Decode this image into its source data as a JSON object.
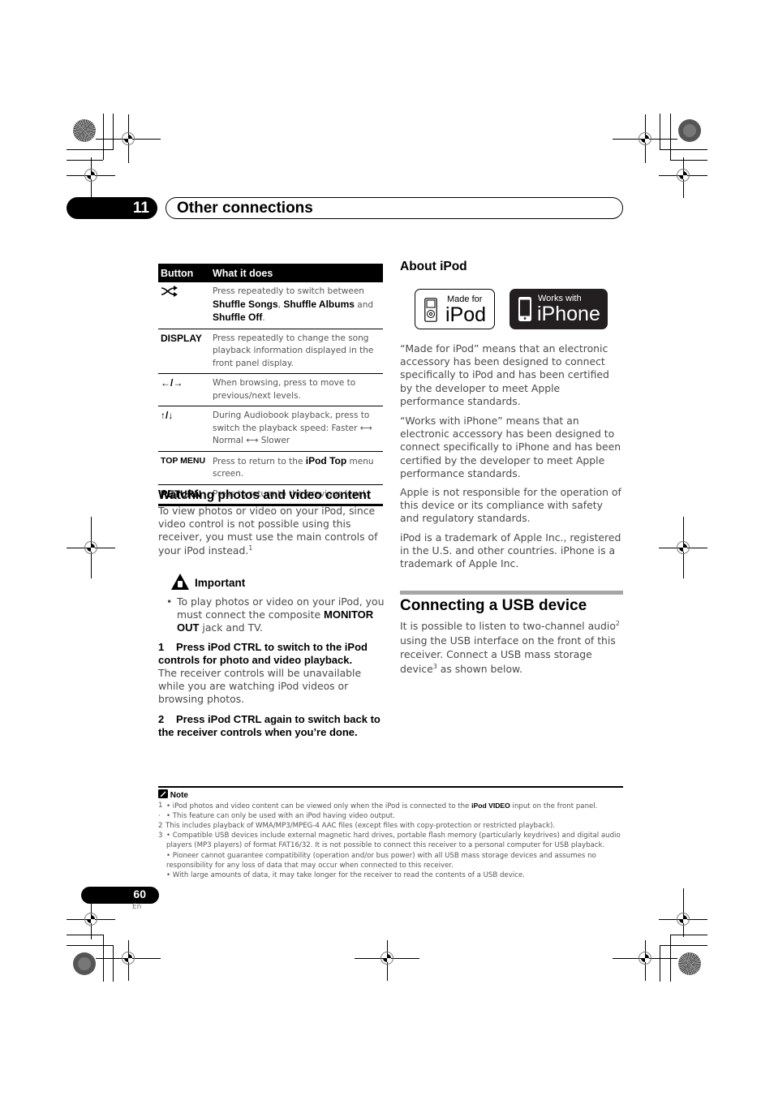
{
  "chapter": {
    "number": "11",
    "title": "Other connections"
  },
  "table": {
    "headers": [
      "Button",
      "What it does"
    ],
    "rows": [
      {
        "button_icon": "shuffle-icon",
        "button": "",
        "desc_parts": [
          "Press repeatedly to switch between ",
          "Shuffle Songs",
          ", ",
          "Shuffle Albums",
          " and ",
          "Shuffle Off",
          "."
        ]
      },
      {
        "button": "DISPLAY",
        "desc": "Press repeatedly to change the song playback information displayed in the front panel display."
      },
      {
        "button": "←/→",
        "button_icon": "left-right-arrows-icon",
        "desc": "When browsing, press to move to previous/next levels."
      },
      {
        "button": "↑/↓",
        "button_icon": "up-down-arrows-icon",
        "desc": "During Audiobook playback, press to switch the playback speed: Faster ⟷ Normal ⟷ Slower"
      },
      {
        "button": "TOP MENU",
        "desc_parts": [
          "Press to return to the ",
          "iPod Top",
          " menu screen."
        ]
      },
      {
        "button": "RETURN",
        "desc": "Press to return to the previous level."
      }
    ]
  },
  "watching": {
    "heading": "Watching photos and video content",
    "intro": "To view photos or video on your iPod, since video control is not possible using this receiver, you must use the main controls of your iPod instead.",
    "intro_footnote": "1",
    "important_label": "Important",
    "important_bullet_parts": [
      "To play photos or video on your iPod, you must connect the composite ",
      "MONITOR OUT",
      " jack and TV."
    ],
    "step1_num": "1",
    "step1": "Press iPod CTRL to switch to the iPod controls for photo and video playback.",
    "step1_body": "The receiver controls will be unavailable while you are watching iPod videos or browsing photos.",
    "step2_num": "2",
    "step2": "Press iPod CTRL again to switch back to the receiver controls when you’re done."
  },
  "about_ipod": {
    "heading": "About iPod",
    "logo1_small": "Made for",
    "logo1_big": "iPod",
    "logo2_small": "Works with",
    "logo2_big": "iPhone",
    "paragraphs": [
      "“Made for iPod” means that an electronic accessory has been designed to connect specifically to iPod and has been certified by the developer to meet Apple performance standards.",
      "“Works with iPhone” means that an electronic accessory has been designed to connect specifically to iPhone and has been certified by the developer to meet Apple performance standards.",
      "Apple is not responsible for the operation of this device or its compliance with safety and regulatory standards.",
      "iPod is a trademark of Apple Inc., registered in the U.S. and other countries. iPhone is a trademark of Apple Inc."
    ]
  },
  "usb": {
    "heading": "Connecting a USB device",
    "text_a": "It is possible to listen to two-channel audio",
    "fn_a": "2",
    "text_b": " using the USB interface on the front of this receiver. Connect a USB mass storage device",
    "fn_b": "3",
    "text_c": " as shown below."
  },
  "notes": {
    "label": "Note",
    "items": [
      {
        "num": "1",
        "parts": [
          "• iPod photos and video content can be viewed only when the iPod is connected to the ",
          "iPod VIDEO",
          " input on the front panel."
        ]
      },
      {
        "num": "·",
        "text": "• This feature can only be used with an iPod having video output."
      },
      {
        "num": "2",
        "text": "This includes playback of WMA/MP3/MPEG-4 AAC files (except files with copy-protection or restricted playback)."
      },
      {
        "num": "3",
        "text": "• Compatible USB devices include external magnetic hard drives, portable flash memory (particularly keydrives) and digital audio players (MP3 players) of format FAT16/32. It is not possible to connect this receiver to a personal computer for USB playback."
      },
      {
        "num": "",
        "text": "• Pioneer cannot guarantee compatibility (operation and/or bus power) with all USB mass storage devices and assumes no responsibility for any loss of data that may occur when connected to this receiver."
      },
      {
        "num": "",
        "text": "• With large amounts of data, it may take longer for the receiver to read the contents of a USB device."
      }
    ]
  },
  "footer": {
    "page_number": "60",
    "language": "En"
  }
}
